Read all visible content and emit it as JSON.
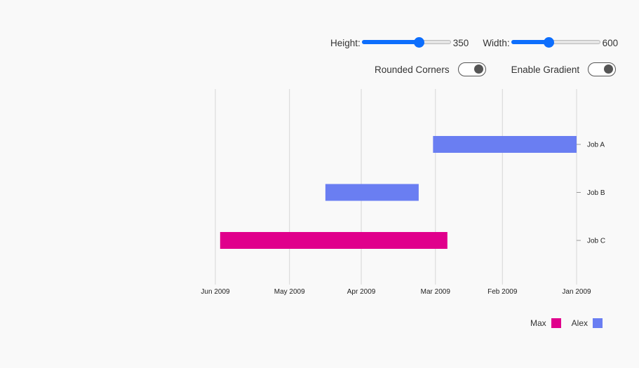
{
  "controls": {
    "height": {
      "label": "Height:",
      "value": "350",
      "fraction": 0.64
    },
    "width": {
      "label": "Width:",
      "value": "600",
      "fraction": 0.42
    },
    "rounded_corners": {
      "label": "Rounded Corners",
      "on": true
    },
    "enable_gradient": {
      "label": "Enable Gradient",
      "on": true
    }
  },
  "chart_data": {
    "type": "gantt",
    "x_reversed": true,
    "x_ticks": [
      "Jan 2009",
      "Feb 2009",
      "Mar 2009",
      "Apr 2009",
      "May 2009",
      "Jun 2009"
    ],
    "tasks": [
      {
        "name": "Job A",
        "owner": "Alex",
        "start": "2009-01-01",
        "end": "2009-03-02"
      },
      {
        "name": "Job B",
        "owner": "Alex",
        "start": "2009-03-08",
        "end": "2009-04-16"
      },
      {
        "name": "Job C",
        "owner": "Max",
        "start": "2009-02-24",
        "end": "2009-05-30"
      }
    ],
    "legend": [
      {
        "name": "Max",
        "color": "#e0008c"
      },
      {
        "name": "Alex",
        "color": "#6a7ef2"
      }
    ],
    "grid": true
  }
}
